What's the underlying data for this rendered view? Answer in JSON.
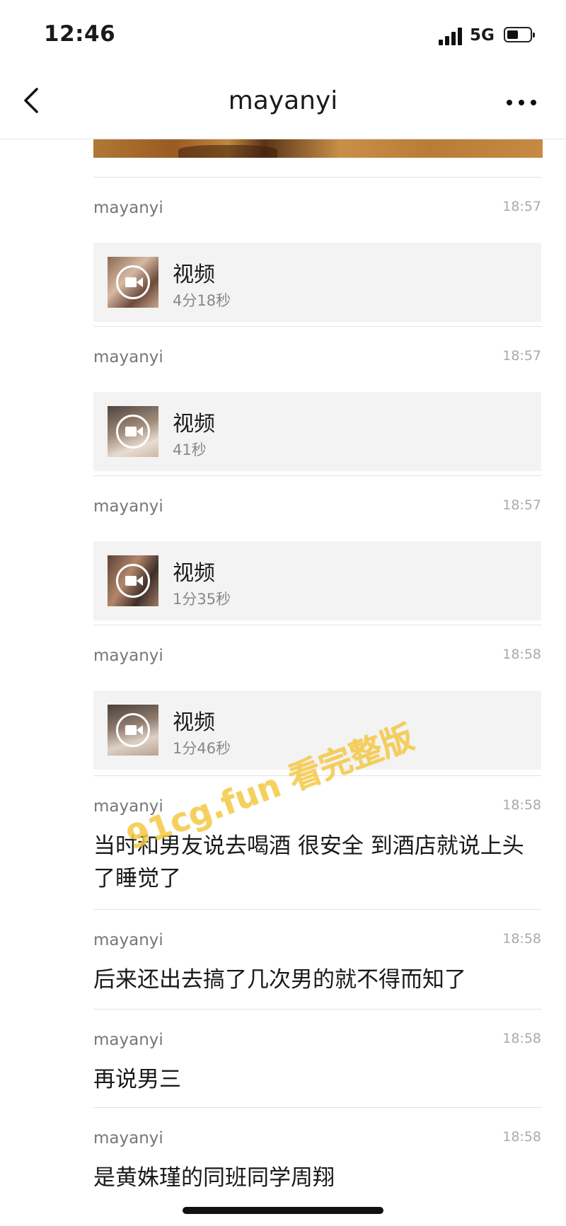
{
  "status_bar": {
    "time": "12:46",
    "network": "5G"
  },
  "nav": {
    "title": "mayanyi"
  },
  "messages": [
    {
      "sender": "mayanyi",
      "time": "18:57",
      "type": "video",
      "title": "视频",
      "duration": "4分18秒"
    },
    {
      "sender": "mayanyi",
      "time": "18:57",
      "type": "video",
      "title": "视频",
      "duration": "41秒"
    },
    {
      "sender": "mayanyi",
      "time": "18:57",
      "type": "video",
      "title": "视频",
      "duration": "1分35秒"
    },
    {
      "sender": "mayanyi",
      "time": "18:58",
      "type": "video",
      "title": "视频",
      "duration": "1分46秒"
    },
    {
      "sender": "mayanyi",
      "time": "18:58",
      "type": "text",
      "text": "当时和男友说去喝酒 很安全 到酒店就说上头了睡觉了"
    },
    {
      "sender": "mayanyi",
      "time": "18:58",
      "type": "text",
      "text": "后来还出去搞了几次男的就不得而知了"
    },
    {
      "sender": "mayanyi",
      "time": "18:58",
      "type": "text",
      "text": "再说男三"
    },
    {
      "sender": "mayanyi",
      "time": "18:58",
      "type": "text",
      "text": "是黄姝瑾的同班同学周翔"
    }
  ],
  "watermark": "91cg.fun 看完整版",
  "icons": {
    "back": "chevron-left-icon",
    "more": "more-horizontal-icon",
    "video": "video-camera-icon",
    "signal": "signal-bars-icon",
    "battery": "battery-icon"
  },
  "colors": {
    "watermark": "#f5c842",
    "card_bg": "#f3f3f3"
  }
}
